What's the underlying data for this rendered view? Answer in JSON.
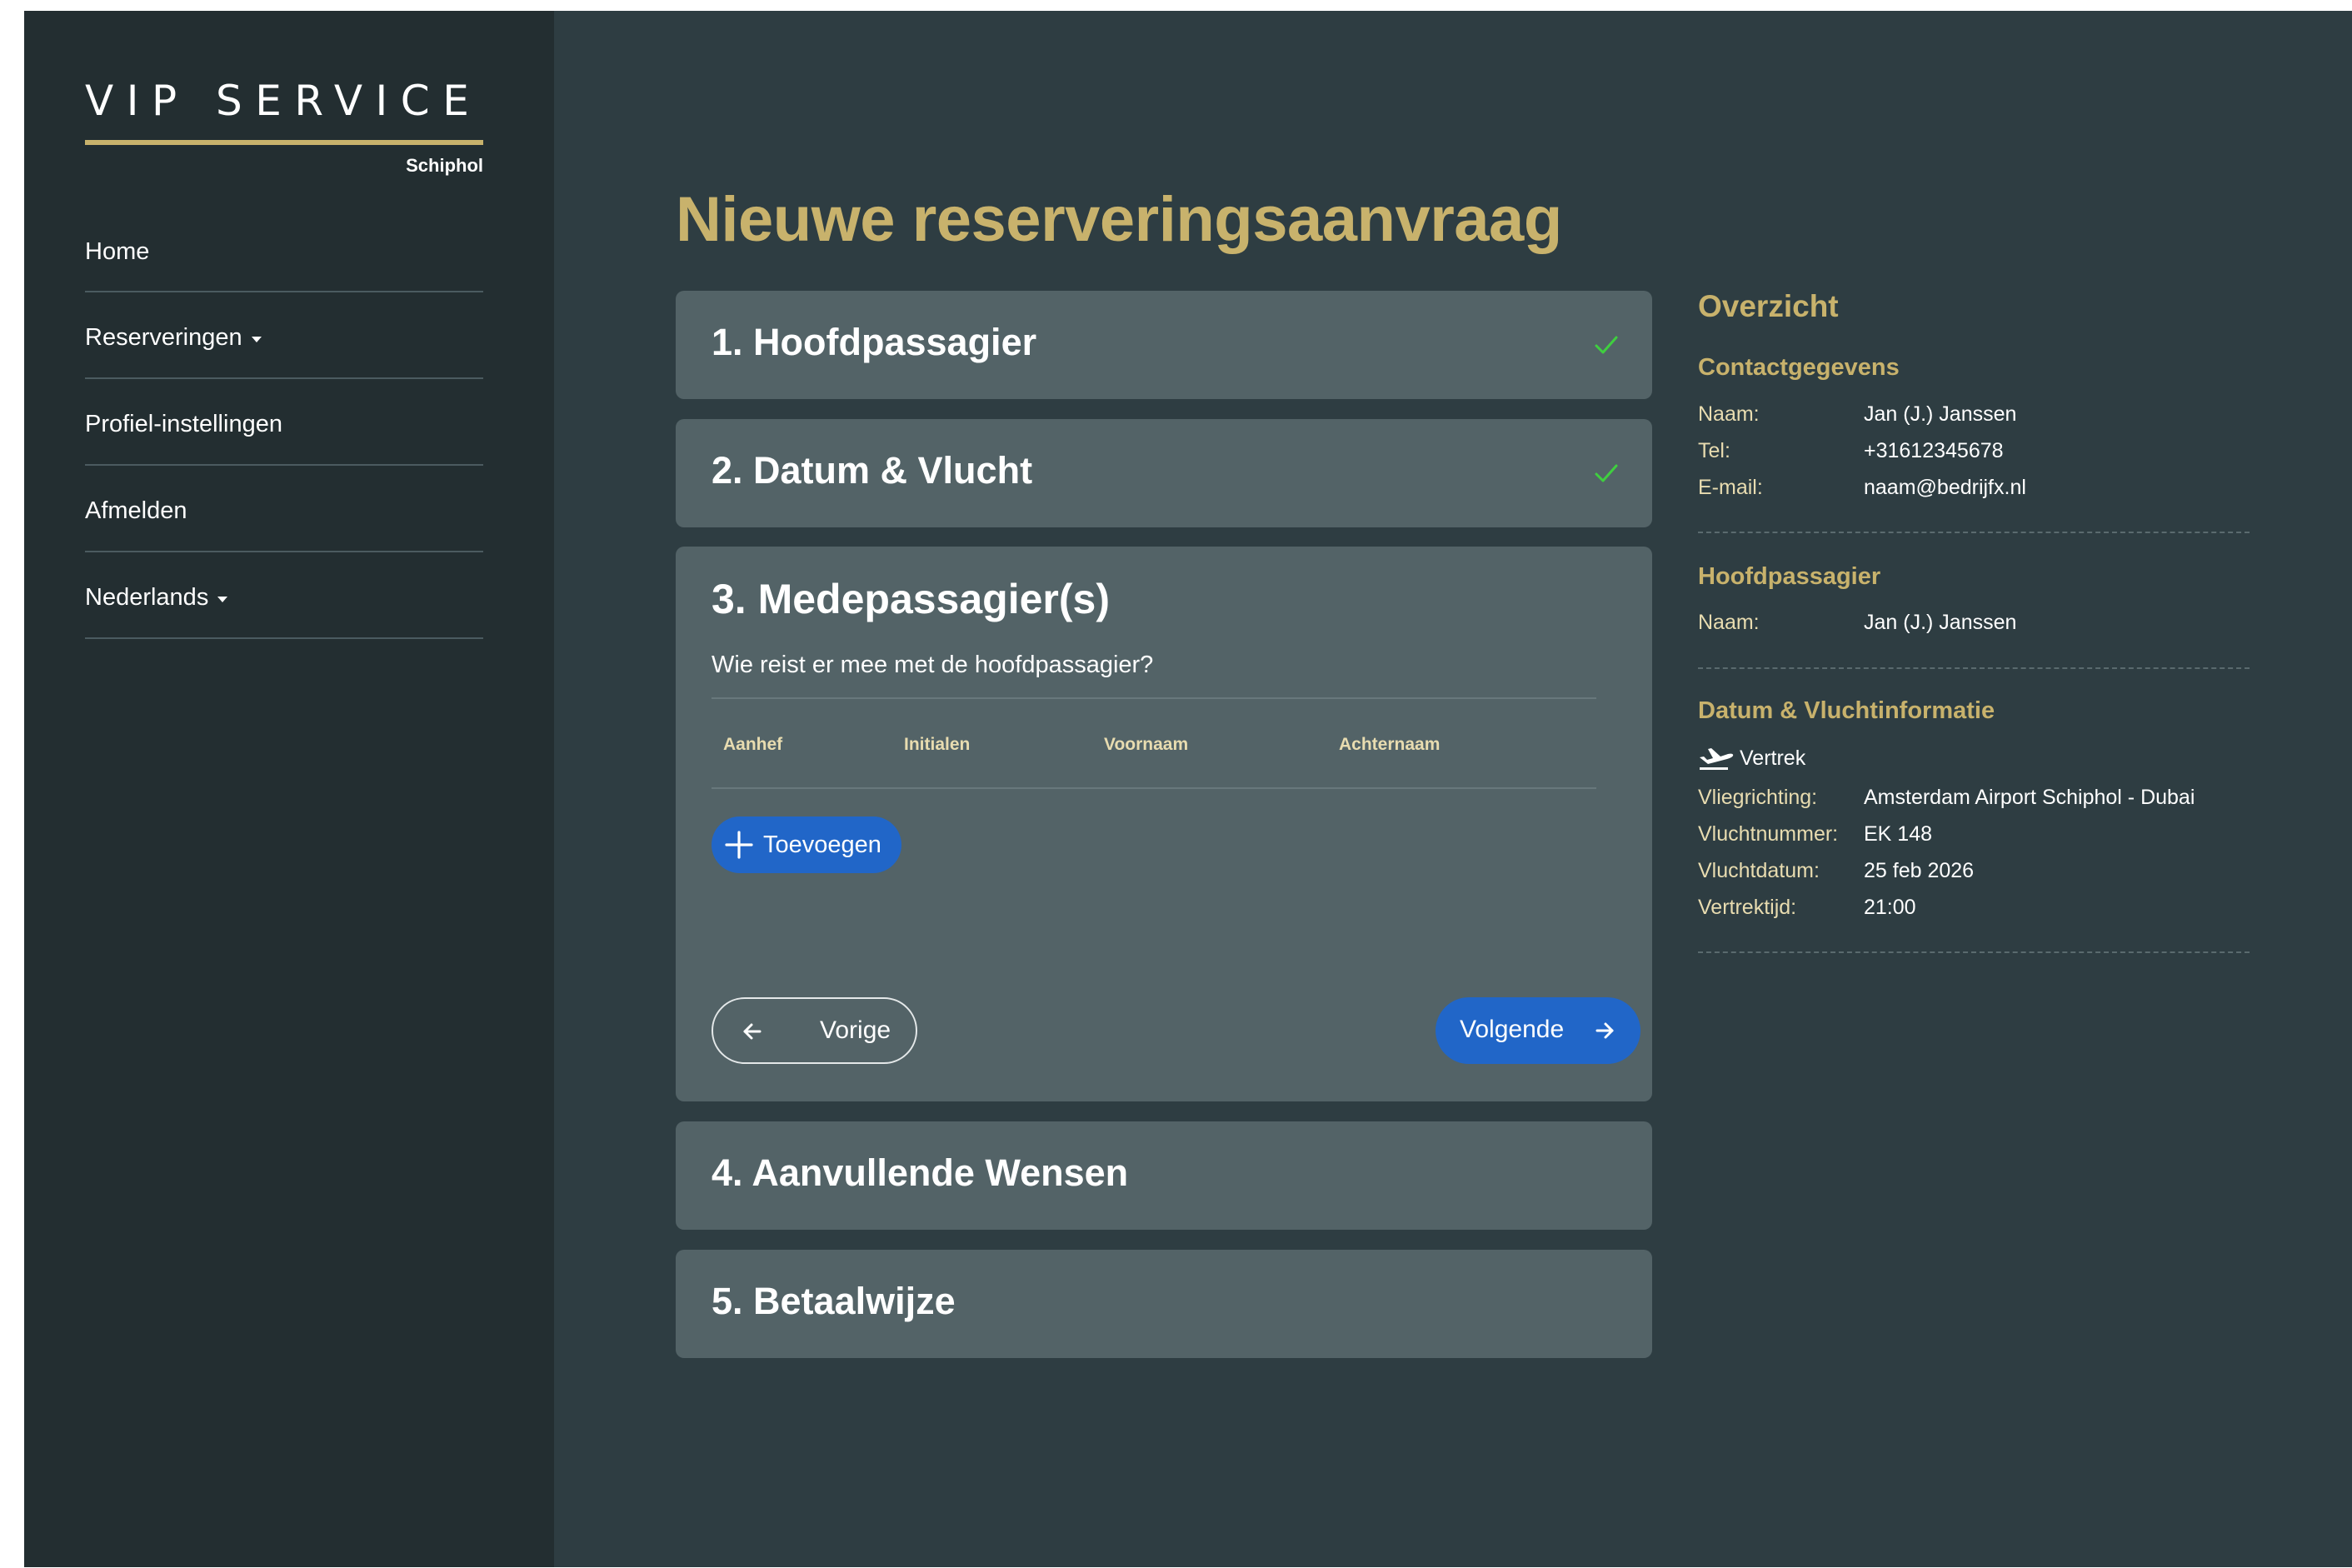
{
  "brand": {
    "title": "VIP SERVICE",
    "subtitle": "Schiphol"
  },
  "nav": {
    "items": [
      {
        "label": "Home",
        "dropdown": false
      },
      {
        "label": "Reserveringen",
        "dropdown": true
      },
      {
        "label": "Profiel-instellingen",
        "dropdown": false
      },
      {
        "label": "Afmelden",
        "dropdown": false
      },
      {
        "label": "Nederlands",
        "dropdown": true
      }
    ]
  },
  "page": {
    "title": "Nieuwe reserveringsaanvraag"
  },
  "steps": [
    {
      "label": "1. Hoofdpassagier",
      "completed": true
    },
    {
      "label": "2. Datum & Vlucht",
      "completed": true
    },
    {
      "label": "3. Medepassagier(s)",
      "completed": false
    },
    {
      "label": "4. Aanvullende Wensen",
      "completed": false
    },
    {
      "label": "5. Betaalwijze",
      "completed": false
    }
  ],
  "passengers_step": {
    "question": "Wie reist er mee met de hoofdpassagier?",
    "columns": [
      "Aanhef",
      "Initialen",
      "Voornaam",
      "Achternaam"
    ],
    "add_label": "Toevoegen",
    "prev_label": "Vorige",
    "next_label": "Volgende"
  },
  "summary": {
    "title": "Overzicht",
    "contact": {
      "heading": "Contactgegevens",
      "rows": [
        {
          "key": "Naam:",
          "value": "Jan (J.) Janssen"
        },
        {
          "key": "Tel:",
          "value": "+31612345678"
        },
        {
          "key": "E-mail:",
          "value": "naam@bedrijfx.nl"
        }
      ]
    },
    "main_passenger": {
      "heading": "Hoofdpassagier",
      "rows": [
        {
          "key": "Naam:",
          "value": "Jan (J.) Janssen"
        }
      ]
    },
    "flight": {
      "heading": "Datum & Vluchtinformatie",
      "departure_label": "Vertrek",
      "rows": [
        {
          "key": "Vliegrichting:",
          "value": "Amsterdam Airport Schiphol - Dubai"
        },
        {
          "key": "Vluchtnummer:",
          "value": "EK 148"
        },
        {
          "key": "Vluchtdatum:",
          "value": "25 feb 2026"
        },
        {
          "key": "Vertrektijd:",
          "value": "21:00"
        }
      ]
    }
  },
  "colors": {
    "gold": "#c8b26c",
    "primary_blue": "#2166c8",
    "sidebar_bg": "#232e31",
    "main_bg": "#2e3d42",
    "panel_bg": "#536367",
    "check_green": "#3fcf3f"
  }
}
